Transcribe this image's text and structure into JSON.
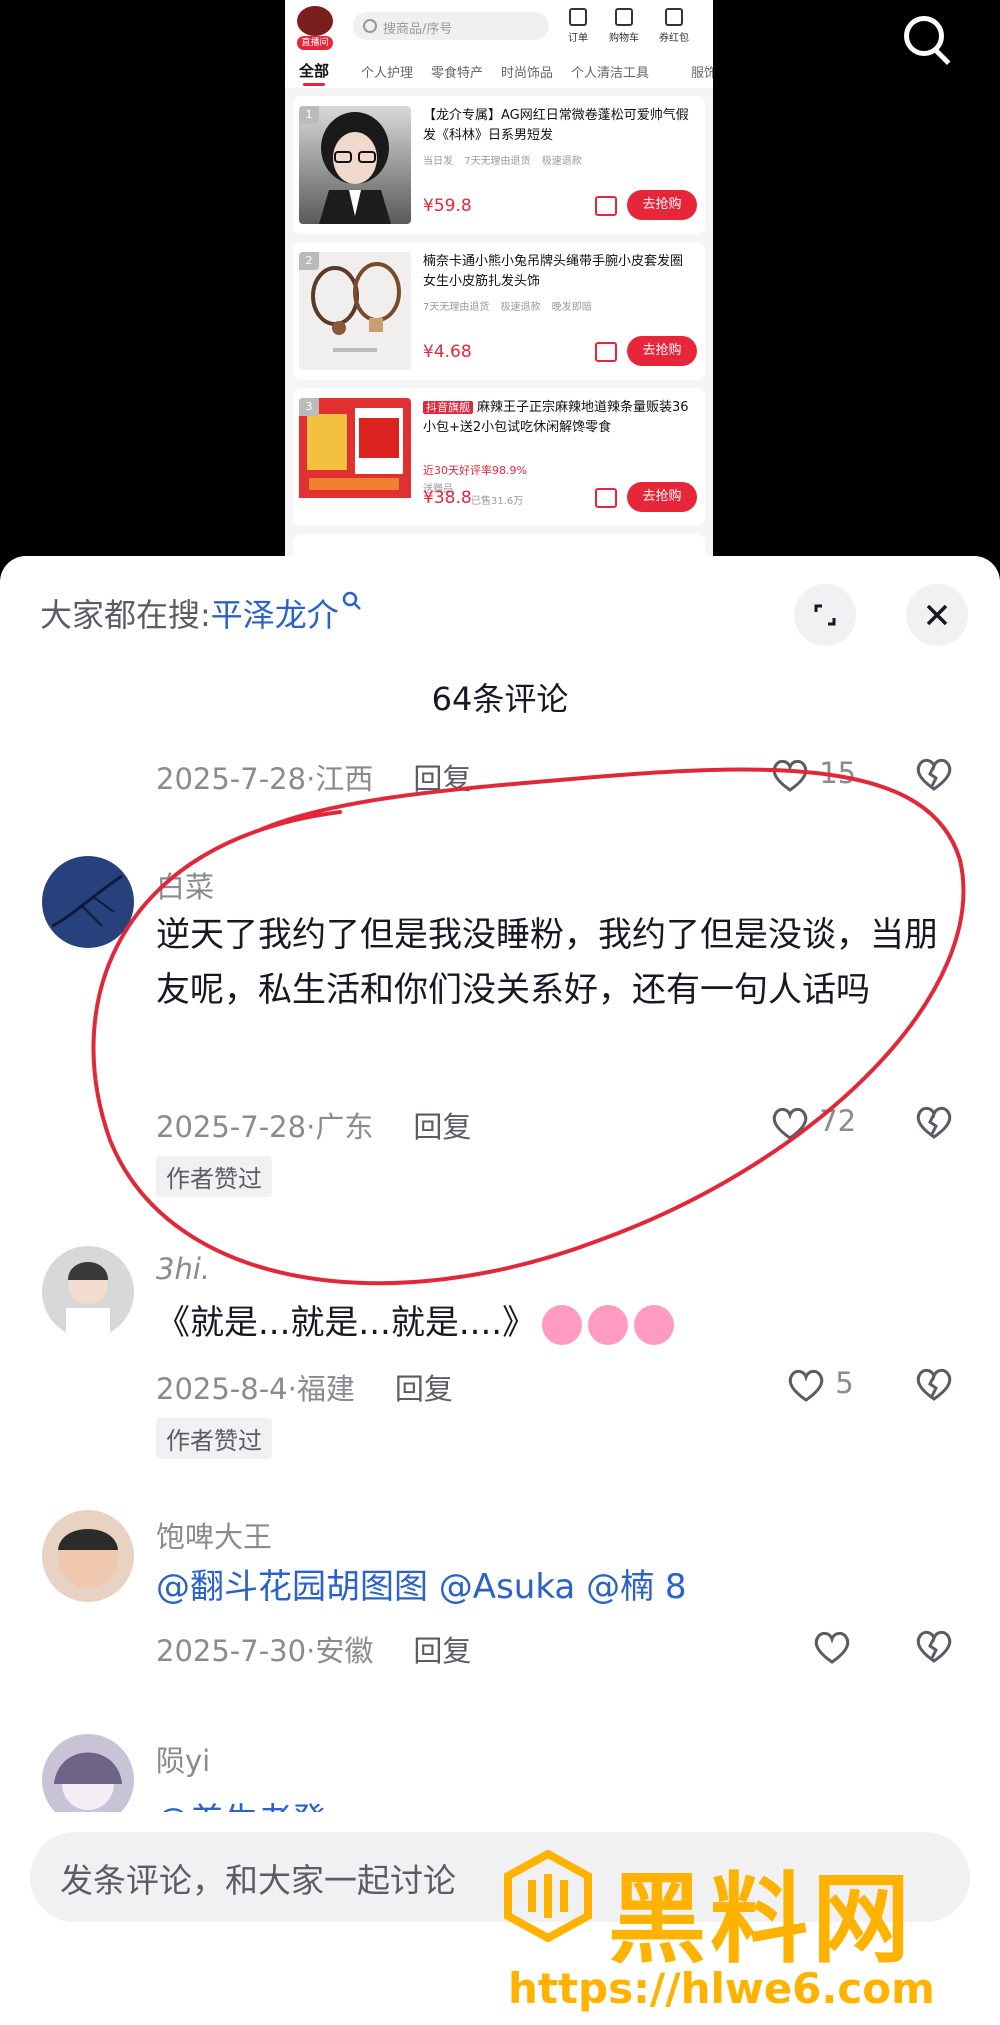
{
  "shop": {
    "logo_tag": "直播间",
    "search_placeholder": "搜商品/序号",
    "header_icons": [
      {
        "name": "orders-icon",
        "label": "订单"
      },
      {
        "name": "cart-icon",
        "label": "购物车"
      },
      {
        "name": "coupon-icon",
        "label": "券红包"
      }
    ],
    "tabs": [
      "全部",
      "个人护理",
      "零食特产",
      "时尚饰品",
      "个人清洁工具",
      "服饰"
    ],
    "buy_label": "去抢购",
    "products": [
      {
        "rank": "1",
        "title": "【龙介专属】AG网红日常微卷蓬松可爱帅气假发《科林》日系男短发",
        "tags": [
          "当日发",
          "7天无理由退货",
          "极速退款"
        ],
        "hot": "",
        "flag": "",
        "price": "¥59.8",
        "sold": ""
      },
      {
        "rank": "2",
        "title": "楠奈卡通小熊小兔吊牌头绳带手腕小皮套发圈女生小皮筋扎发头饰",
        "tags": [
          "7天无理由退货",
          "极速退款",
          "晚发即赔"
        ],
        "hot": "",
        "flag": "",
        "price": "¥4.68",
        "sold": ""
      },
      {
        "rank": "3",
        "title": "麻辣王子正宗麻辣地道辣条量贩装36小包+送2小包试吃休闲解馋零食",
        "tags": [
          "送赠品"
        ],
        "hot": "近30天好评率98.9%",
        "flag": "抖音旗舰",
        "price": "¥38.8",
        "sold": "已售31.6万"
      }
    ]
  },
  "sheet": {
    "trend_prefix": "大家都在搜:",
    "trend_keyword": "平泽龙介",
    "comment_count": "64条评论",
    "comments": [
      {
        "user": "",
        "text": "",
        "date": "2025-7-28",
        "region": "江西",
        "reply": "回复",
        "likes": "15",
        "author_liked": ""
      },
      {
        "user": "白菜",
        "text": "逆天了我约了但是我没睡粉，我约了但是没谈，当朋友呢，私生活和你们没关系好，还有一句人话吗",
        "date": "2025-7-28",
        "region": "广东",
        "reply": "回复",
        "likes": "72",
        "author_liked": "作者赞过"
      },
      {
        "user": "3hi.",
        "text": "《就是...就是...就是....》",
        "date": "2025-8-4",
        "region": "福建",
        "reply": "回复",
        "likes": "5",
        "author_liked": "作者赞过"
      },
      {
        "user": "饱啤大王",
        "text": "@翻斗花园胡图图 @Asuka @楠 8",
        "date": "2025-7-30",
        "region": "安徽",
        "reply": "回复",
        "likes": "",
        "author_liked": ""
      },
      {
        "user": "陨yi",
        "text": "@差生老登",
        "date": "",
        "region": "",
        "reply": "",
        "likes": "",
        "author_liked": ""
      }
    ],
    "input_placeholder": "发条评论，和大家一起讨论"
  },
  "watermark": {
    "brand": "黑料网",
    "url": "https://hlwe6.com"
  },
  "colors": {
    "accent_red": "#e8263a",
    "link_blue": "#2a62c9",
    "annotation_red": "#e0283a",
    "watermark_gold": "#ffb300"
  }
}
